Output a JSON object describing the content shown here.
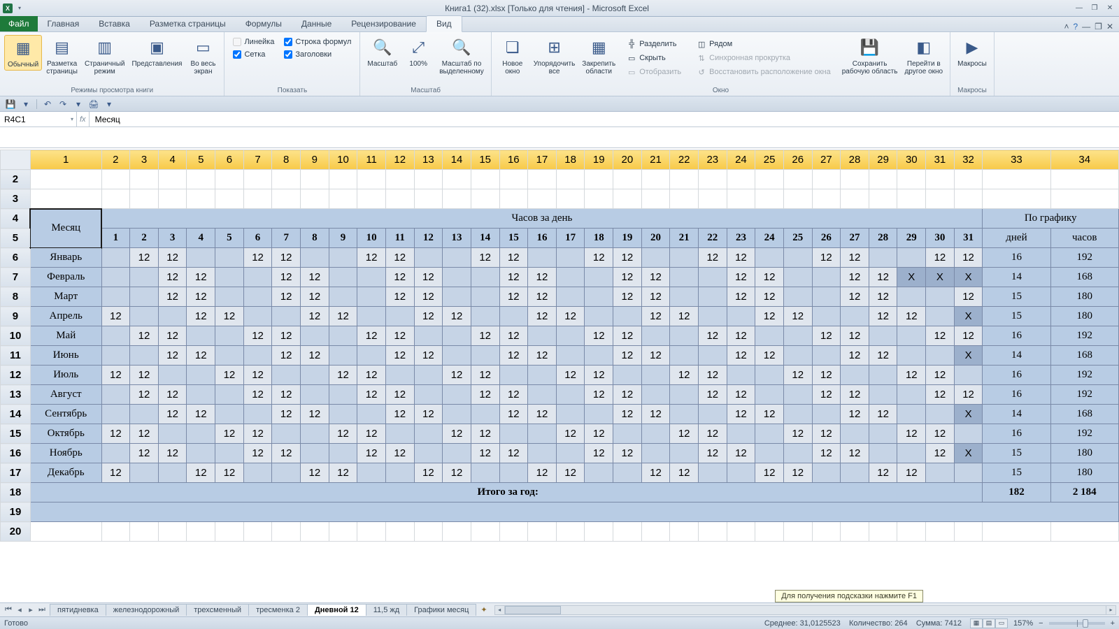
{
  "title": "Книга1 (32).xlsx  [Только для чтения]  -  Microsoft Excel",
  "tabs": {
    "file": "Файл",
    "items": [
      "Главная",
      "Вставка",
      "Разметка страницы",
      "Формулы",
      "Данные",
      "Рецензирование",
      "Вид"
    ],
    "active": "Вид"
  },
  "ribbon": {
    "g1": {
      "label": "Режимы просмотра книги",
      "b1": "Обычный",
      "b2": "Разметка\nстраницы",
      "b3": "Страничный\nрежим",
      "b4": "Представления",
      "b5": "Во весь\nэкран"
    },
    "g2": {
      "label": "Показать",
      "c1": "Линейка",
      "c2": "Строка формул",
      "c3": "Сетка",
      "c4": "Заголовки"
    },
    "g3": {
      "label": "Масштаб",
      "b1": "Масштаб",
      "b2": "100%",
      "b3": "Масштаб по\nвыделенному"
    },
    "g4": {
      "label": "Окно",
      "b1": "Новое\nокно",
      "b2": "Упорядочить\nвсе",
      "b3": "Закрепить\nобласти",
      "r1": "Разделить",
      "r2": "Скрыть",
      "r3": "Отобразить",
      "r4": "Рядом",
      "r5": "Синхронная прокрутка",
      "r6": "Восстановить расположение окна",
      "b4": "Сохранить\nрабочую область",
      "b5": "Перейти в\nдругое окно"
    },
    "g5": {
      "label": "Макросы",
      "b1": "Макросы"
    }
  },
  "namebox": "R4C1",
  "formula": "Месяц",
  "colHeaders": [
    "1",
    "2",
    "3",
    "4",
    "5",
    "6",
    "7",
    "8",
    "9",
    "10",
    "11",
    "12",
    "13",
    "14",
    "15",
    "16",
    "17",
    "18",
    "19",
    "20",
    "21",
    "22",
    "23",
    "24",
    "25",
    "26",
    "27",
    "28",
    "29",
    "30",
    "31",
    "32",
    "33",
    "34"
  ],
  "rowHeaders": [
    "2",
    "3",
    "4",
    "5",
    "6",
    "7",
    "8",
    "9",
    "10",
    "11",
    "12",
    "13",
    "14",
    "15",
    "16",
    "17",
    "18",
    "19",
    "20"
  ],
  "table": {
    "title_month": "Месяц",
    "title_hours": "Часов за день",
    "title_sched": "По графику",
    "days": [
      "1",
      "2",
      "3",
      "4",
      "5",
      "6",
      "7",
      "8",
      "9",
      "10",
      "11",
      "12",
      "13",
      "14",
      "15",
      "16",
      "17",
      "18",
      "19",
      "20",
      "21",
      "22",
      "23",
      "24",
      "25",
      "26",
      "27",
      "28",
      "29",
      "30",
      "31"
    ],
    "col_days": "дней",
    "col_hours": "часов",
    "months": [
      {
        "name": "Январь",
        "vals": [
          "",
          "12",
          "12",
          "",
          "",
          "12",
          "12",
          "",
          "",
          "12",
          "12",
          "",
          "",
          "12",
          "12",
          "",
          "",
          "12",
          "12",
          "",
          "",
          "12",
          "12",
          "",
          "",
          "12",
          "12",
          "",
          "",
          "12",
          "12"
        ],
        "d": "16",
        "h": "192"
      },
      {
        "name": "Февраль",
        "vals": [
          "",
          "",
          "12",
          "12",
          "",
          "",
          "12",
          "12",
          "",
          "",
          "12",
          "12",
          "",
          "",
          "12",
          "12",
          "",
          "",
          "12",
          "12",
          "",
          "",
          "12",
          "12",
          "",
          "",
          "12",
          "12",
          "X",
          "X",
          "X"
        ],
        "d": "14",
        "h": "168"
      },
      {
        "name": "Март",
        "vals": [
          "",
          "",
          "12",
          "12",
          "",
          "",
          "12",
          "12",
          "",
          "",
          "12",
          "12",
          "",
          "",
          "12",
          "12",
          "",
          "",
          "12",
          "12",
          "",
          "",
          "12",
          "12",
          "",
          "",
          "12",
          "12",
          "",
          "",
          "12"
        ],
        "d": "15",
        "h": "180"
      },
      {
        "name": "Апрель",
        "vals": [
          "12",
          "",
          "",
          "12",
          "12",
          "",
          "",
          "12",
          "12",
          "",
          "",
          "12",
          "12",
          "",
          "",
          "12",
          "12",
          "",
          "",
          "12",
          "12",
          "",
          "",
          "12",
          "12",
          "",
          "",
          "12",
          "12",
          "",
          "X"
        ],
        "d": "15",
        "h": "180"
      },
      {
        "name": "Май",
        "vals": [
          "",
          "12",
          "12",
          "",
          "",
          "12",
          "12",
          "",
          "",
          "12",
          "12",
          "",
          "",
          "12",
          "12",
          "",
          "",
          "12",
          "12",
          "",
          "",
          "12",
          "12",
          "",
          "",
          "12",
          "12",
          "",
          "",
          "12",
          "12"
        ],
        "d": "16",
        "h": "192"
      },
      {
        "name": "Июнь",
        "vals": [
          "",
          "",
          "12",
          "12",
          "",
          "",
          "12",
          "12",
          "",
          "",
          "12",
          "12",
          "",
          "",
          "12",
          "12",
          "",
          "",
          "12",
          "12",
          "",
          "",
          "12",
          "12",
          "",
          "",
          "12",
          "12",
          "",
          "",
          "X"
        ],
        "d": "14",
        "h": "168"
      },
      {
        "name": "Июль",
        "vals": [
          "12",
          "12",
          "",
          "",
          "12",
          "12",
          "",
          "",
          "12",
          "12",
          "",
          "",
          "12",
          "12",
          "",
          "",
          "12",
          "12",
          "",
          "",
          "12",
          "12",
          "",
          "",
          "12",
          "12",
          "",
          "",
          "12",
          "12",
          ""
        ],
        "d": "16",
        "h": "192"
      },
      {
        "name": "Август",
        "vals": [
          "",
          "12",
          "12",
          "",
          "",
          "12",
          "12",
          "",
          "",
          "12",
          "12",
          "",
          "",
          "12",
          "12",
          "",
          "",
          "12",
          "12",
          "",
          "",
          "12",
          "12",
          "",
          "",
          "12",
          "12",
          "",
          "",
          "12",
          "12"
        ],
        "d": "16",
        "h": "192"
      },
      {
        "name": "Сентябрь",
        "vals": [
          "",
          "",
          "12",
          "12",
          "",
          "",
          "12",
          "12",
          "",
          "",
          "12",
          "12",
          "",
          "",
          "12",
          "12",
          "",
          "",
          "12",
          "12",
          "",
          "",
          "12",
          "12",
          "",
          "",
          "12",
          "12",
          "",
          "",
          "X"
        ],
        "d": "14",
        "h": "168"
      },
      {
        "name": "Октябрь",
        "vals": [
          "12",
          "12",
          "",
          "",
          "12",
          "12",
          "",
          "",
          "12",
          "12",
          "",
          "",
          "12",
          "12",
          "",
          "",
          "12",
          "12",
          "",
          "",
          "12",
          "12",
          "",
          "",
          "12",
          "12",
          "",
          "",
          "12",
          "12",
          ""
        ],
        "d": "16",
        "h": "192"
      },
      {
        "name": "Ноябрь",
        "vals": [
          "",
          "12",
          "12",
          "",
          "",
          "12",
          "12",
          "",
          "",
          "12",
          "12",
          "",
          "",
          "12",
          "12",
          "",
          "",
          "12",
          "12",
          "",
          "",
          "12",
          "12",
          "",
          "",
          "12",
          "12",
          "",
          "",
          "12",
          "X"
        ],
        "d": "15",
        "h": "180"
      },
      {
        "name": "Декабрь",
        "vals": [
          "12",
          "",
          "",
          "12",
          "12",
          "",
          "",
          "12",
          "12",
          "",
          "",
          "12",
          "12",
          "",
          "",
          "12",
          "12",
          "",
          "",
          "12",
          "12",
          "",
          "",
          "12",
          "12",
          "",
          "",
          "12",
          "12",
          "",
          ""
        ],
        "d": "15",
        "h": "180"
      }
    ],
    "total_label": "Итого за год:",
    "total_days": "182",
    "total_hours": "2 184"
  },
  "sheets": {
    "items": [
      "пятидневка",
      "железнодорожный",
      "трехсменный",
      "тресменка 2",
      "Дневной 12",
      "11,5 жд",
      "Графики месяц"
    ],
    "active": "Дневной 12"
  },
  "tooltip": "Для получения подсказки нажмите F1",
  "status": {
    "ready": "Готово",
    "avg_l": "Среднее:",
    "avg": "31,0125523",
    "cnt_l": "Количество:",
    "cnt": "264",
    "sum_l": "Сумма:",
    "sum": "7412",
    "zoom": "157%"
  }
}
